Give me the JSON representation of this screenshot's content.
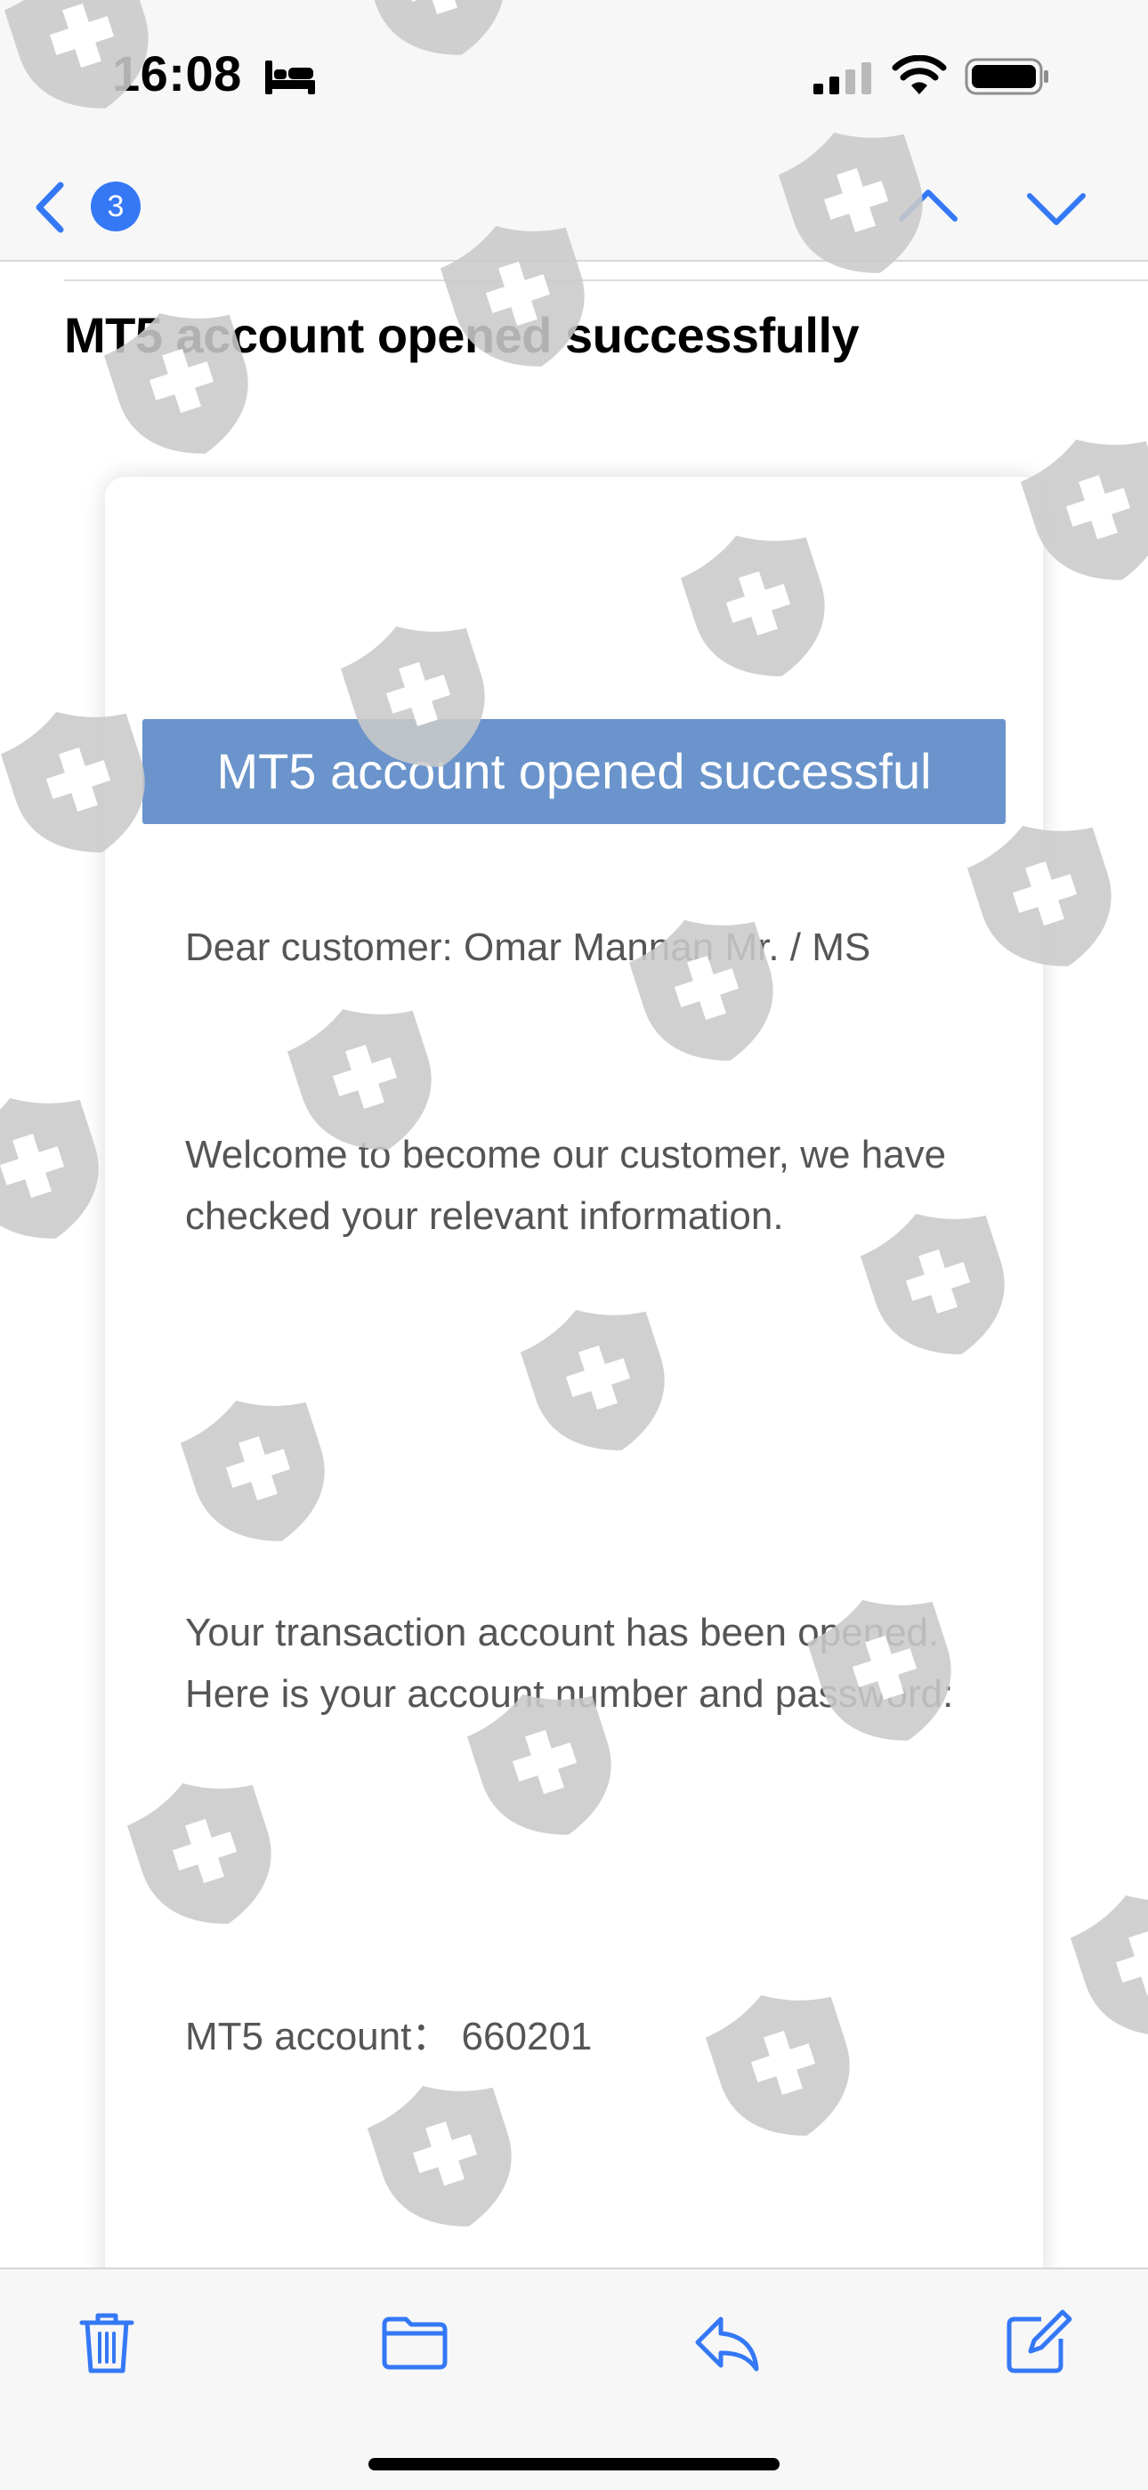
{
  "status_bar": {
    "time": "16:08",
    "icons": [
      "bed-icon",
      "cellular-signal-icon",
      "wifi-icon",
      "battery-icon"
    ]
  },
  "nav": {
    "unread_count": "3",
    "icons": [
      "chevron-left-icon",
      "chevron-up-icon",
      "chevron-down-icon"
    ],
    "accent_color": "#3478f6"
  },
  "email": {
    "subject": "MT5 account opened successfully",
    "banner": "MT5 account opened successful",
    "banner_color": "#6a94cb",
    "greeting": "Dear customer: Omar Mannan Mr. / MS",
    "welcome": "Welcome to become our customer, we have checked your relevant information.",
    "transaction": "Your transaction account has been opened. Here is your account number and password:",
    "account_line": "MT5 account： 660201"
  },
  "toolbar": {
    "icons": [
      "trash-icon",
      "folder-icon",
      "reply-icon",
      "compose-icon"
    ]
  },
  "watermark": {
    "icon": "shield-cross-icon",
    "color": "#c9c9c9"
  }
}
